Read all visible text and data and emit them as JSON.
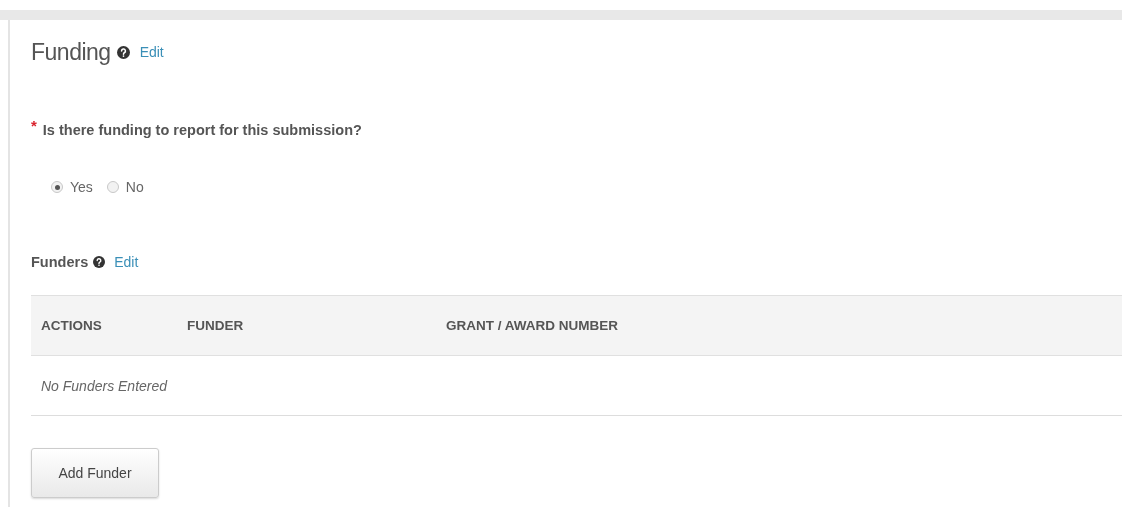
{
  "section": {
    "title": "Funding",
    "edit_link": "Edit"
  },
  "question": {
    "required_mark": "*",
    "text": "Is there funding to report for this submission?"
  },
  "options": [
    {
      "label": "Yes",
      "selected": true
    },
    {
      "label": "No",
      "selected": false
    }
  ],
  "funders": {
    "title": "Funders",
    "edit_link": "Edit"
  },
  "table": {
    "columns": [
      "ACTIONS",
      "FUNDER",
      "GRANT / AWARD NUMBER"
    ],
    "empty_message": "No Funders Entered"
  },
  "buttons": [
    "Add Funder"
  ]
}
